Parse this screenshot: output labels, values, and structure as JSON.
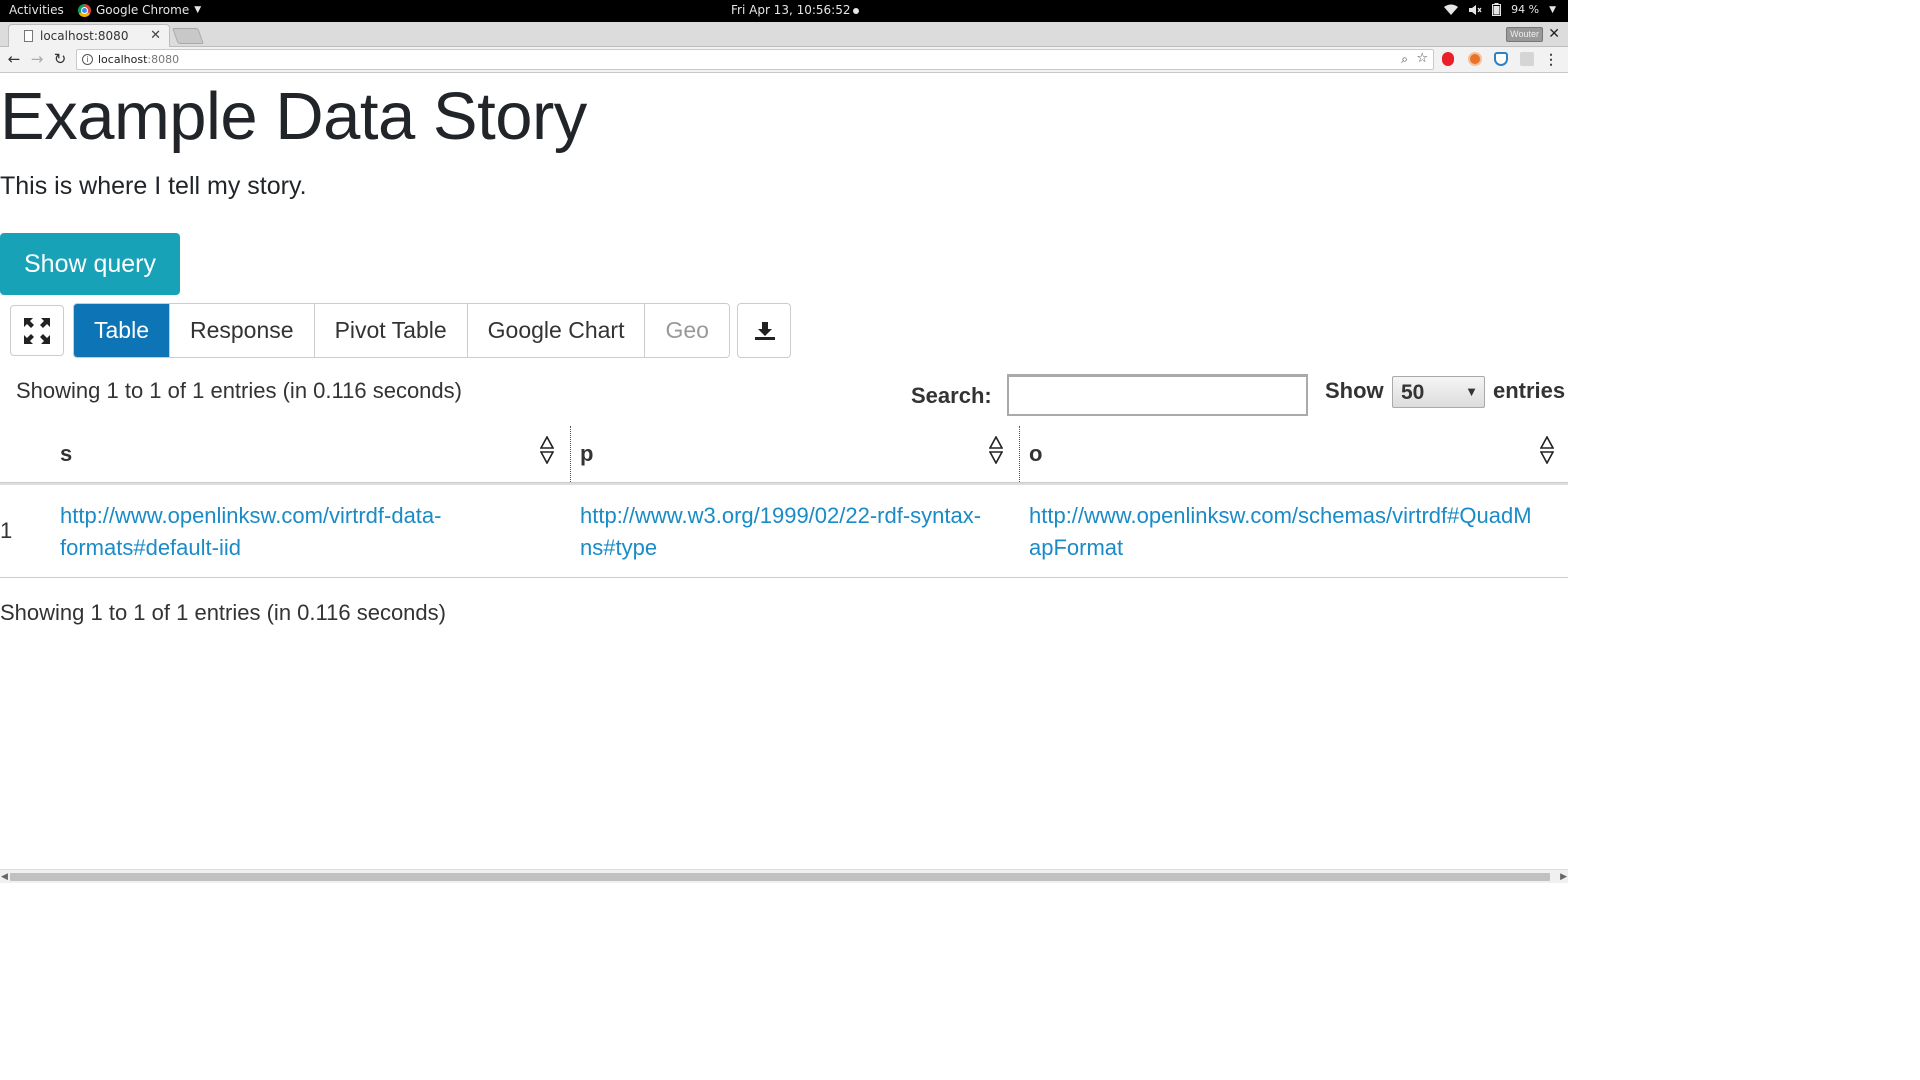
{
  "system_bar": {
    "activities": "Activities",
    "app_name": "Google Chrome",
    "clock": "Fri Apr 13, 10:56:52",
    "battery": "94 %"
  },
  "browser": {
    "tab_title": "localhost:8080",
    "url_host": "localhost",
    "url_port": ":8080",
    "profile": "Wouter"
  },
  "page": {
    "title": "Example Data Story",
    "intro": "This is where I tell my story.",
    "show_query_label": "Show query",
    "view_tabs": [
      {
        "label": "Table",
        "state": "active"
      },
      {
        "label": "Response",
        "state": "normal"
      },
      {
        "label": "Pivot Table",
        "state": "normal"
      },
      {
        "label": "Google Chart",
        "state": "normal"
      },
      {
        "label": "Geo",
        "state": "disabled"
      }
    ],
    "info_top": "Showing 1 to 1 of 1 entries (in 0.116 seconds)",
    "search_label": "Search:",
    "search_value": "",
    "show_label": "Show",
    "page_length": "50",
    "entries_label": "entries",
    "columns": [
      "s",
      "p",
      "o"
    ],
    "rows": [
      {
        "num": "1",
        "s_line1": "http://www.openlinksw.com/virtrdf-data-",
        "s_line2": "formats#default-iid",
        "p_line1": "http://www.w3.org/1999/02/22-rdf-syntax-",
        "p_line2": "ns#type",
        "o_line1": "http://www.openlinksw.com/schemas/virtrdf#QuadM",
        "o_line2": "apFormat"
      }
    ],
    "info_bottom": "Showing 1 to 1 of 1 entries (in 0.116 seconds)"
  },
  "colors": {
    "show_query_bg": "#17a2b8",
    "active_tab_bg": "#0d74b6",
    "link": "#1a8bc6"
  }
}
